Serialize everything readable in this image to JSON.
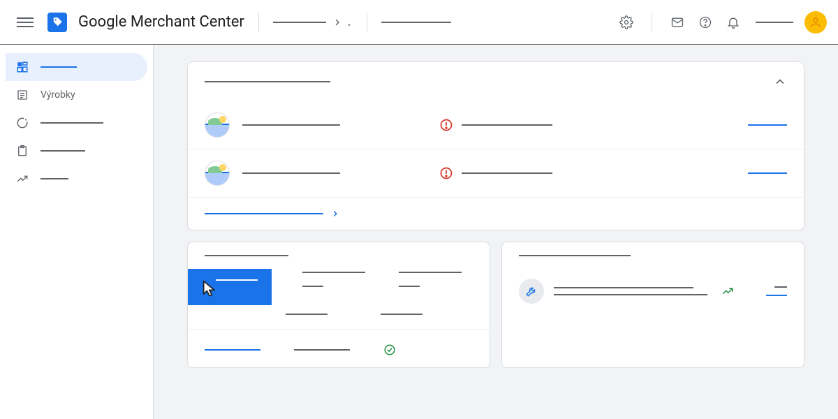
{
  "header": {
    "app_title": "Google Merchant Center",
    "icons": {
      "settings": "gear",
      "mail": "mail",
      "help": "help",
      "notifications": "bell",
      "avatar": "user"
    }
  },
  "sidebar": {
    "items": [
      {
        "label": "",
        "icon": "dashboard",
        "active": true
      },
      {
        "label": "Výrobky",
        "icon": "list",
        "active": false
      },
      {
        "label": "",
        "icon": "progress",
        "active": false
      },
      {
        "label": "",
        "icon": "clipboard",
        "active": false
      },
      {
        "label": "",
        "icon": "trending",
        "active": false
      }
    ]
  },
  "overview_card": {
    "title": "",
    "alerts": [
      {
        "name": "",
        "message": "",
        "action": ""
      },
      {
        "name": "",
        "message": "",
        "action": ""
      }
    ],
    "footer_link": ""
  },
  "products_card": {
    "title": "",
    "highlight_label": "",
    "columns": [
      {
        "top": "",
        "bottom": ""
      },
      {
        "top": "",
        "bottom": ""
      }
    ],
    "status_label": "",
    "link": ""
  },
  "tips_card": {
    "title": "",
    "tip": {
      "line1": "",
      "line2": "",
      "meta": "",
      "action": ""
    }
  },
  "colors": {
    "primary": "#1a73e8",
    "error": "#d93025",
    "success": "#1e8e3e",
    "accent": "#fbbc04"
  }
}
